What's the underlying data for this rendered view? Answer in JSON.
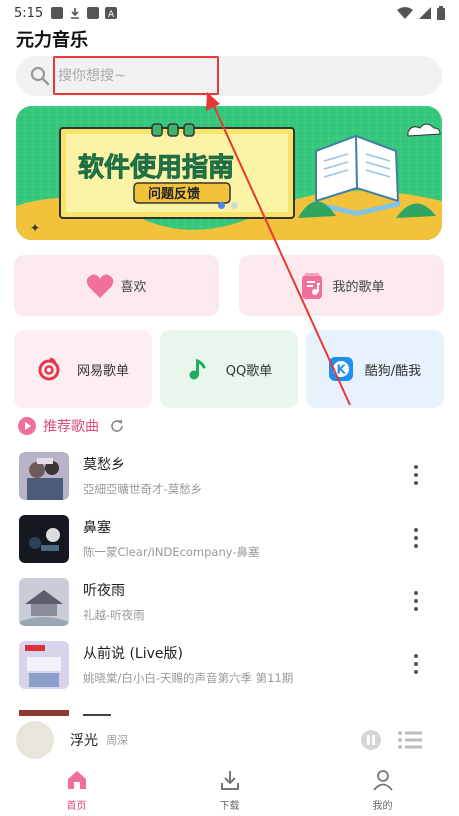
{
  "status_bar": {
    "time": "5:15"
  },
  "app": {
    "title": "元力音乐"
  },
  "search": {
    "placeholder": "搜你想搜~"
  },
  "banner": {
    "title": "软件使用指南",
    "button": "问题反馈",
    "colors": {
      "background": "#34c77b",
      "board": "#f7d33b",
      "title": "#2fb56c"
    }
  },
  "quick_cards": [
    {
      "label": "喜欢",
      "icon": "heart-icon"
    },
    {
      "label": "我的歌单",
      "icon": "playlist-icon"
    }
  ],
  "sources": [
    {
      "label": "网易歌单",
      "icon": "netease-icon",
      "bg": "#fdeef1"
    },
    {
      "label": "QQ歌单",
      "icon": "qq-music-icon",
      "bg": "#e9f6ec"
    },
    {
      "label": "酷狗/酷我",
      "icon": "kugou-icon",
      "bg": "#e8f2fd"
    }
  ],
  "recommend": {
    "label": "推荐歌曲"
  },
  "songs": [
    {
      "title": "莫愁乡",
      "subtitle": "亞細亞曠世奇才-莫愁乡"
    },
    {
      "title": "鼻塞",
      "subtitle": "陈一蒙Clear/INDEcompany-鼻塞"
    },
    {
      "title": "听夜雨",
      "subtitle": "礼越-听夜雨"
    },
    {
      "title": "从前说 (Live版)",
      "subtitle": "姚晓棠/白小白-天赐的声音第六季 第11期"
    }
  ],
  "player": {
    "title": "浮光",
    "artist": "周深"
  },
  "tabs": [
    {
      "label": "首页",
      "icon": "home-icon"
    },
    {
      "label": "下载",
      "icon": "download-icon"
    },
    {
      "label": "我的",
      "icon": "profile-icon"
    }
  ],
  "accent": "#e24a7a"
}
